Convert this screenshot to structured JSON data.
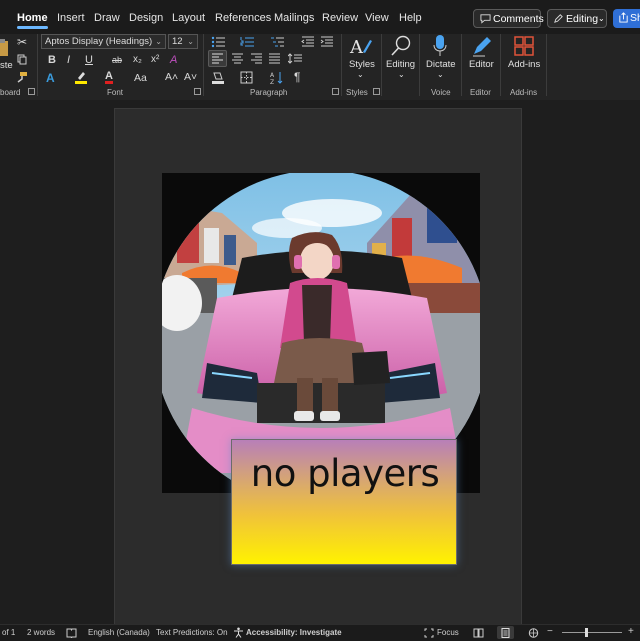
{
  "tabs": [
    "Home",
    "Insert",
    "Draw",
    "Design",
    "Layout",
    "References",
    "Mailings",
    "Review",
    "View",
    "Help"
  ],
  "header_buttons": {
    "comments": "Comments",
    "editing": "Editing",
    "share": "Sh"
  },
  "ribbon": {
    "clipboard": {
      "paste_label": "ste",
      "group_label": "board"
    },
    "font": {
      "name": "Aptos Display (Headings)",
      "size": "12",
      "group_label": "Font",
      "row2": [
        "B",
        "I",
        "U",
        "ab",
        "x₂",
        "x²",
        "A"
      ],
      "row3": [
        "A",
        "A",
        "A",
        "Aa",
        "A˄",
        "A˅"
      ]
    },
    "paragraph": {
      "group_label": "Paragraph",
      "pilcrow": "¶"
    },
    "styles": {
      "label": "Styles",
      "group_label": "Styles"
    },
    "editing": {
      "label": "Editing"
    },
    "voice": {
      "label": "Dictate",
      "group_label": "Voice"
    },
    "editor": {
      "label": "Editor",
      "group_label": "Editor"
    },
    "addins": {
      "label": "Add-ins",
      "group_label": "Add-ins"
    }
  },
  "document": {
    "textbox_text": "no players"
  },
  "status": {
    "page": "of 1",
    "words": "2 words",
    "language": "English (Canada)",
    "predictions": "Text Predictions: On",
    "accessibility": "Accessibility: Investigate",
    "focus": "Focus"
  }
}
